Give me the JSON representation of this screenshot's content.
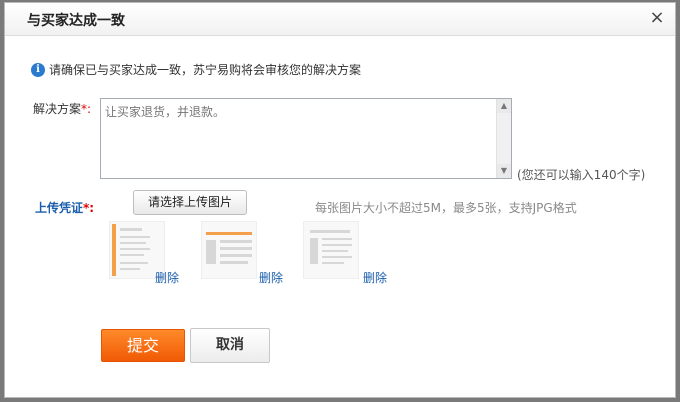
{
  "dialog": {
    "title": "与买家达成一致",
    "close_label": "×"
  },
  "info": {
    "icon": "info-icon",
    "icon_glyph": "i",
    "text": "请确保已与买家达成一致，苏宁易购将会审核您的解决方案"
  },
  "solution": {
    "label": "解决方案",
    "required_mark": "*:",
    "placeholder": "让买家退货，并退款。",
    "char_hint": "(您还可以输入140个字)"
  },
  "upload": {
    "label": "上传凭证",
    "required_mark": "*:",
    "button_label": "请选择上传图片",
    "hint": "每张图片大小不超过5M，最多5张，支持JPG格式",
    "delete_labels": [
      "删除",
      "删除",
      "删除"
    ]
  },
  "actions": {
    "submit_label": "提交",
    "cancel_label": "取消"
  },
  "colors": {
    "accent_orange": "#f26c0e",
    "link_blue": "#1b5fac",
    "required_red": "#e40000"
  }
}
